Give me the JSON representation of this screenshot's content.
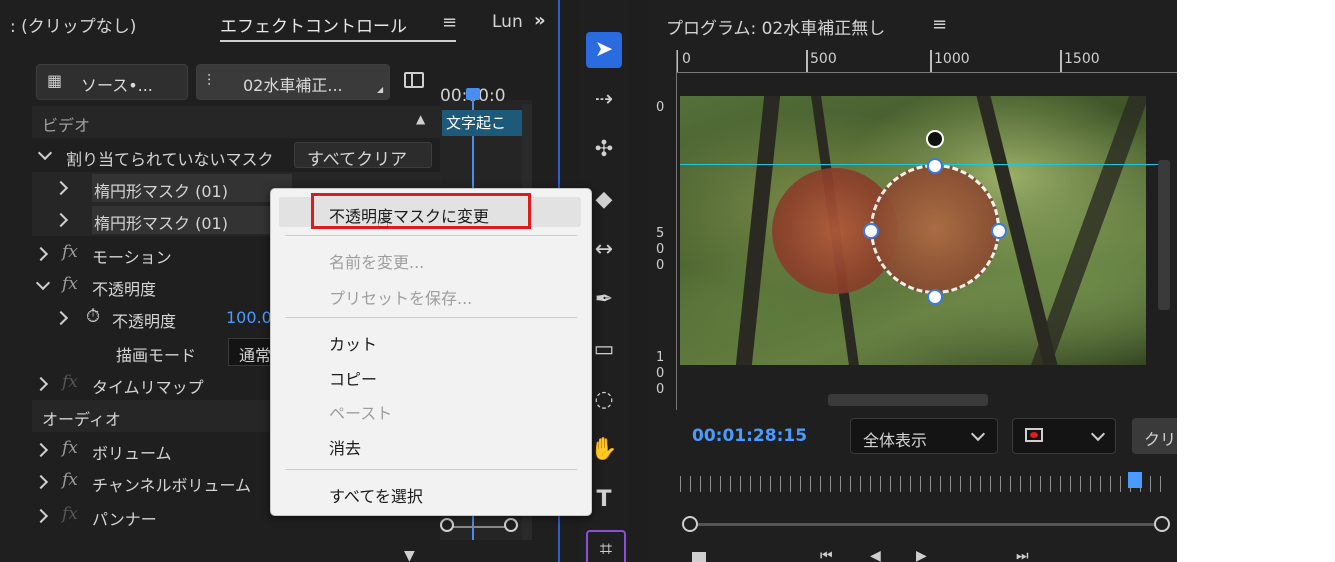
{
  "effect_controls": {
    "clip_label": ": (クリップなし)",
    "tab_title": "エフェクトコントロール",
    "next_tab": "Lun",
    "source_btn": "ソース•...",
    "sequence_btn": "02水車補正...",
    "timecode": "00:00:0",
    "caption_clip": "文字起こ",
    "video_header": "ビデオ",
    "unassigned_masks": "割り当てられていないマスク",
    "clear_all": "すべてクリア",
    "mask1": "楕円形マスク (01)",
    "mask2": "楕円形マスク (01)",
    "fx_symbol": "fx",
    "motion": "モーション",
    "opacity": "不透明度",
    "opacity_param": "不透明度",
    "opacity_value": "100.0",
    "blend_mode_label": "描画モード",
    "blend_mode_value": "通常",
    "time_remap": "タイムリマップ",
    "audio_header": "オーディオ",
    "volume": "ボリューム",
    "channel_volume": "チャンネルボリューム",
    "panner": "パンナー"
  },
  "context_menu": {
    "items": [
      {
        "label": "不透明度マスクに変更",
        "enabled": true,
        "highlighted": true
      },
      {
        "label": "名前を変更...",
        "enabled": false
      },
      {
        "label": "プリセットを保存...",
        "enabled": false
      },
      {
        "label": "カット",
        "enabled": true
      },
      {
        "label": "コピー",
        "enabled": true
      },
      {
        "label": "ペースト",
        "enabled": false
      },
      {
        "label": "消去",
        "enabled": true
      },
      {
        "label": "すべてを選択",
        "enabled": true
      }
    ]
  },
  "program_monitor": {
    "title": "プログラム: 02水車補正無し",
    "ruler_ticks": [
      "0",
      "500",
      "1000",
      "1500"
    ],
    "ruler_v_ticks": [
      "0",
      "5\n0\n0",
      "1\n0\n0"
    ],
    "timecode": "00:01:28:15",
    "zoom": "全体表示",
    "next_btn": "クリ"
  },
  "colors": {
    "accent_blue": "#2b6be0",
    "timecode_blue": "#4a9bff",
    "highlight_red": "#e01b1b"
  }
}
